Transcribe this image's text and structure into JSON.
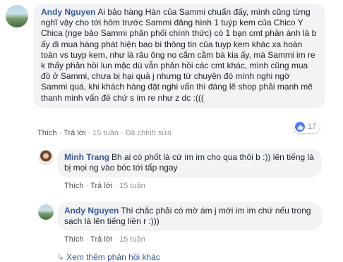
{
  "comment": {
    "author": "Andy Nguyen",
    "text": "Ai bảo hàng Hàn của Sammi chuẩn đấy, mình cũng từng nghĩ vậy cho tới hôm trước Sammi đăng hình 1 tuýp kem của Chico Y Chica (nge bảo Sammi phân phối chính thức) có 1 bạn cmt phản ánh là b ấy đi mua hàng phát hiện bao bì thông tin của tuyp kem khác xa hoàn toàn vs tuyp kem, như là râu ông nọ cắm cằm bà kia ấy, mà Sammi im re k thấy phản hồi lun mặc dù vẫn phản hồi các cmt khác, mình cũng mua đồ ở Sammi, chưa bị hại quả j nhưng từ chuyện đó mình nghi ngờ Sammi quá, khi khách hàng đặt nghi vấn thì đáng lẽ shop phải mạnh mẽ thanh minh vấn đề chứ s im re như z dc :(((",
    "like_label": "Thích",
    "reply_label": "Trả lời",
    "time": "15 tuần",
    "edited": "Đã chỉnh sửa",
    "reaction_count": "17"
  },
  "replies": [
    {
      "author": "Minh Trang",
      "text": "Bh ai có phốt là cứ im im cho qua thôi b :)) lên tiếng là bị mọi ng vào bóc tới tấp ngay",
      "like_label": "Thích",
      "reply_label": "Trả lời",
      "time": "15 tuần"
    },
    {
      "author": "Andy Nguyen",
      "text": "Thì chắc phải có mờ ám j mới im im chứ nếu trong sạch là lên tiếng liền r :)))",
      "like_label": "Thích",
      "reply_label": "Trả lời",
      "time": "15 tuần"
    }
  ],
  "more_replies_label": "Xem thêm phản hồi khác",
  "colors": {
    "link": "#385898",
    "bubble": "#f2f3f5",
    "like": "#4c7ff0"
  }
}
